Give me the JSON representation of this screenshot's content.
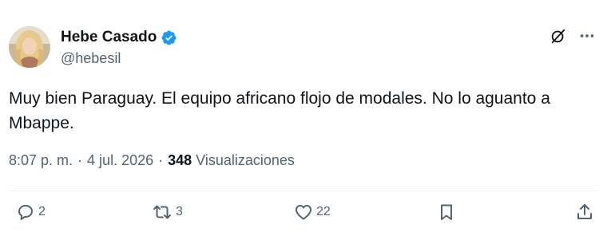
{
  "author": {
    "display_name": "Hebe Casado",
    "handle": "@hebesil",
    "verified": true,
    "avatar_icon": "avatar-photo"
  },
  "tweet": {
    "text": "Muy bien Paraguay. El equipo africano flojo de modales. No lo aguanto a Mbappe."
  },
  "meta": {
    "time": "8:07 p. m.",
    "separator": "·",
    "date": "4 jul. 2026",
    "views_count": "348",
    "views_label": "Visualizaciones"
  },
  "actions": {
    "reply_count": "2",
    "retweet_count": "3",
    "like_count": "22",
    "bookmark_count": "",
    "share_count": ""
  },
  "colors": {
    "text_primary": "#0f1419",
    "text_secondary": "#536471",
    "verified_blue": "#1d9bf0",
    "divider": "#eff3f4"
  },
  "icons": [
    "grok-icon",
    "more-icon",
    "verified-badge-icon",
    "reply-icon",
    "retweet-icon",
    "like-icon",
    "bookmark-icon",
    "share-icon"
  ]
}
